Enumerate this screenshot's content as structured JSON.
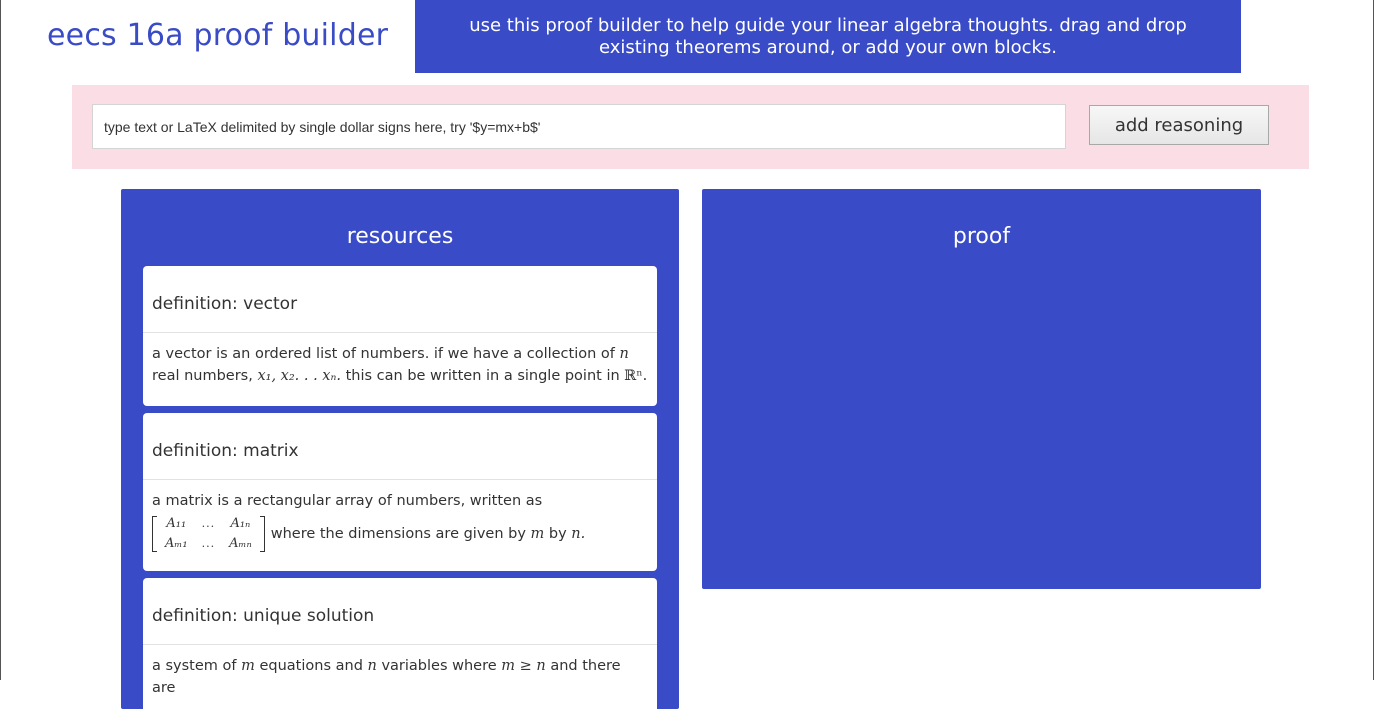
{
  "header": {
    "title": "eecs 16a proof builder",
    "banner_line1": "use this proof builder to help guide your linear algebra thoughts. drag and drop",
    "banner_line2": "existing theorems around, or add your own blocks."
  },
  "input_bar": {
    "placeholder": "type text or LaTeX delimited by single dollar signs here, try '$y=mx+b$'",
    "value": "",
    "button_label": "add reasoning"
  },
  "resources": {
    "title": "resources",
    "cards": [
      {
        "title": "definition: vector",
        "body_pre": "a vector is an ordered list of numbers. if we have a collection of",
        "var_n": "n",
        "body_mid": "real numbers,",
        "seq": "x₁, x₂. . . xₙ.",
        "body_post": "this can be written in a single point in",
        "space": "ℝⁿ."
      },
      {
        "title": "definition: matrix",
        "body_pre": "a matrix is a rectangular array of numbers, written as",
        "matrix": {
          "r1c1": "A₁₁",
          "r1c2": "...",
          "r1c3": "A₁ₙ",
          "r2c1": "Aₘ₁",
          "r2c2": "...",
          "r2c3": "Aₘₙ"
        },
        "body_post": "where the dimensions are given by",
        "var_m": "m",
        "by": "by",
        "var_n": "n."
      },
      {
        "title": "definition: unique solution",
        "body_pre": "a system of",
        "var_m": "m",
        "body_mid": "equations and",
        "var_n": "n",
        "body_mid2": "variables where",
        "ineq": "m ≥ n",
        "body_post": "and there are"
      }
    ]
  },
  "proof": {
    "title": "proof"
  },
  "colors": {
    "primary_blue": "#394bc6",
    "title_blue": "#3a4bc6",
    "pink_bar": "#fbdde5",
    "card_bg": "#ffffff"
  }
}
